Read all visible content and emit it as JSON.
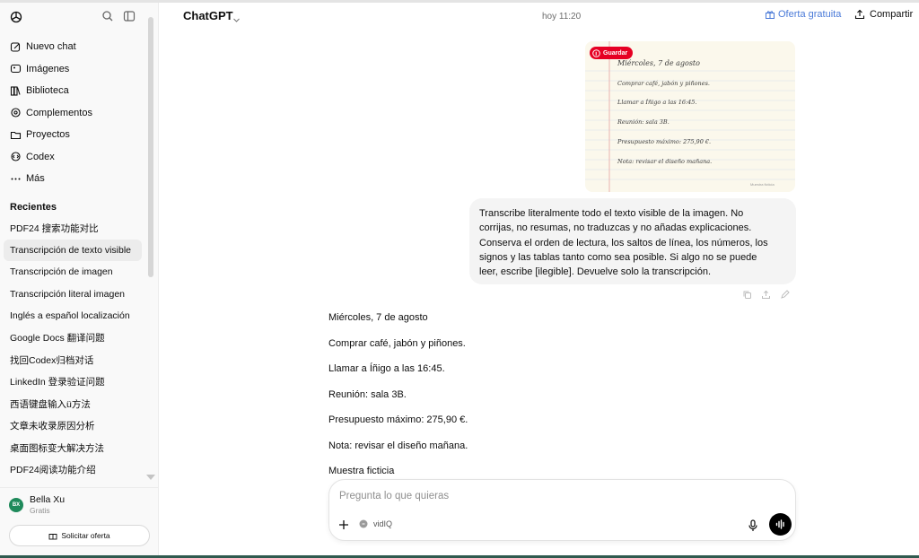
{
  "sidebar": {
    "nav": [
      {
        "label": "Nuevo chat",
        "icon": "new-chat-icon"
      },
      {
        "label": "Imágenes",
        "icon": "images-icon"
      },
      {
        "label": "Biblioteca",
        "icon": "library-icon"
      },
      {
        "label": "Complementos",
        "icon": "plugins-icon"
      },
      {
        "label": "Proyectos",
        "icon": "folder-icon"
      },
      {
        "label": "Codex",
        "icon": "codex-icon"
      },
      {
        "label": "Más",
        "icon": "more-icon"
      }
    ],
    "recents_heading": "Recientes",
    "recents": [
      "PDF24 搜索功能对比",
      "Transcripción de texto visible",
      "Transcripción de imagen",
      "Transcripción literal imagen",
      "Inglés a español localización",
      "Google Docs 翻译问题",
      "找回Codex归档对话",
      "LinkedIn 登录验证问题",
      "西语键盘输入ü方法",
      "文章未收录原因分析",
      "桌面图标变大解决方法",
      "PDF24阅读功能介绍"
    ],
    "user": {
      "initials": "BX",
      "name": "Bella Xu",
      "plan": "Gratis"
    },
    "offer_button": "Solicitar oferta"
  },
  "header": {
    "title": "ChatGPT",
    "timestamp": "hoy 11:20",
    "offer_link": "Oferta gratuita",
    "share": "Compartir"
  },
  "attachment": {
    "save_badge": "Guardar",
    "note_lines": [
      "Miércoles, 7 de agosto",
      "Comprar café, jabón y piñones.",
      "Llamar a Íñigo a las 16:45.",
      "Reunión: sala 3B.",
      "Presupuesto máximo: 275,90 €.",
      "Nota: revisar el diseño mañana."
    ],
    "watermark": "Muestra ficticia"
  },
  "user_message": {
    "lines": [
      "Transcribe literalmente todo el texto visible de la imagen. No",
      "corrijas, no resumas, no traduzcas y no añadas explicaciones.",
      "Conserva el orden de lectura, los saltos de línea, los números, los",
      "signos y las tablas tanto como sea posible. Si algo no se puede",
      "leer, escribe [ilegible]. Devuelve solo la transcripción."
    ]
  },
  "assistant_message": {
    "lines": [
      "Miércoles, 7 de agosto",
      "Comprar café, jabón y piñones.",
      "Llamar a Íñigo a las 16:45.",
      "Reunión: sala 3B.",
      "Presupuesto máximo: 275,90 €.",
      "Nota: revisar el diseño mañana.",
      "Muestra ficticia"
    ]
  },
  "composer": {
    "placeholder": "Pregunta lo que quieras",
    "tool_label": "vidIQ"
  }
}
